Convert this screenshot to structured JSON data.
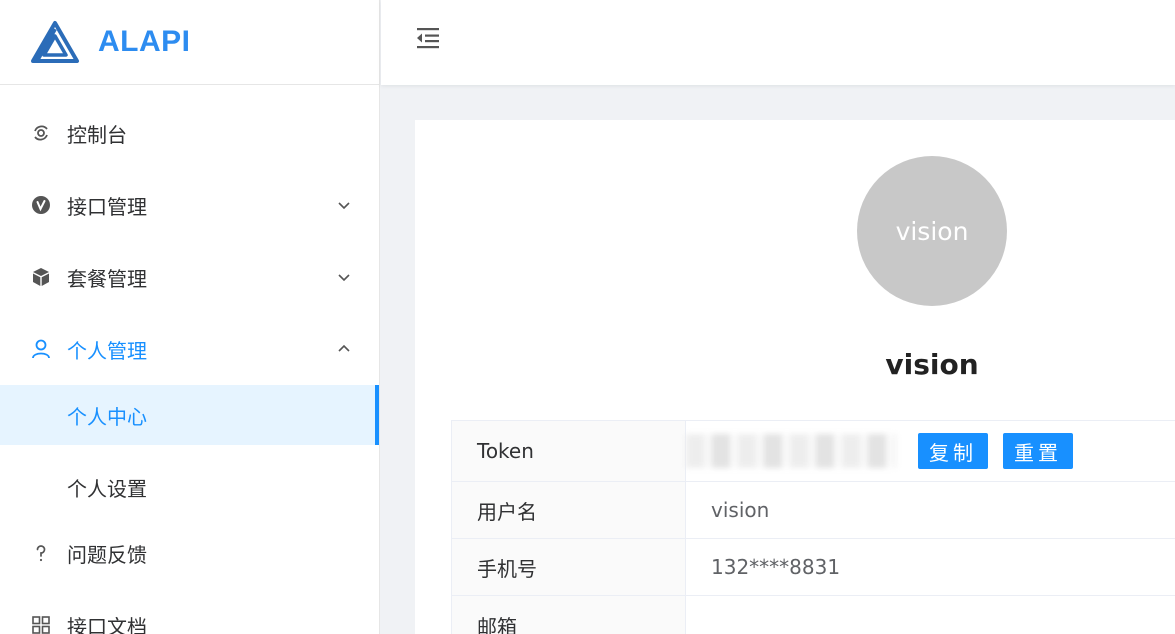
{
  "brand": {
    "name": "ALAPI",
    "color": "#2d8cf0"
  },
  "accent": "#1890ff",
  "sidebar": {
    "items": [
      {
        "label": "控制台",
        "icon": "dashboard-icon"
      },
      {
        "label": "接口管理",
        "icon": "api-icon",
        "expandable": true,
        "expanded": false
      },
      {
        "label": "套餐管理",
        "icon": "package-icon",
        "expandable": true,
        "expanded": false
      },
      {
        "label": "个人管理",
        "icon": "user-icon",
        "expandable": true,
        "expanded": true,
        "children": [
          {
            "label": "个人中心",
            "active": true
          },
          {
            "label": "个人设置",
            "active": false
          }
        ]
      },
      {
        "label": "问题反馈",
        "icon": "question-icon"
      },
      {
        "label": "接口文档",
        "icon": "grid-icon"
      }
    ]
  },
  "profile": {
    "avatar_text": "vision",
    "username": "vision",
    "fields": [
      {
        "label": "Token",
        "value": ""
      },
      {
        "label": "用户名",
        "value": "vision"
      },
      {
        "label": "手机号",
        "value": "132****8831"
      },
      {
        "label": "邮箱",
        "value": ""
      }
    ],
    "copy_label": "复制",
    "reset_label": "重置"
  }
}
